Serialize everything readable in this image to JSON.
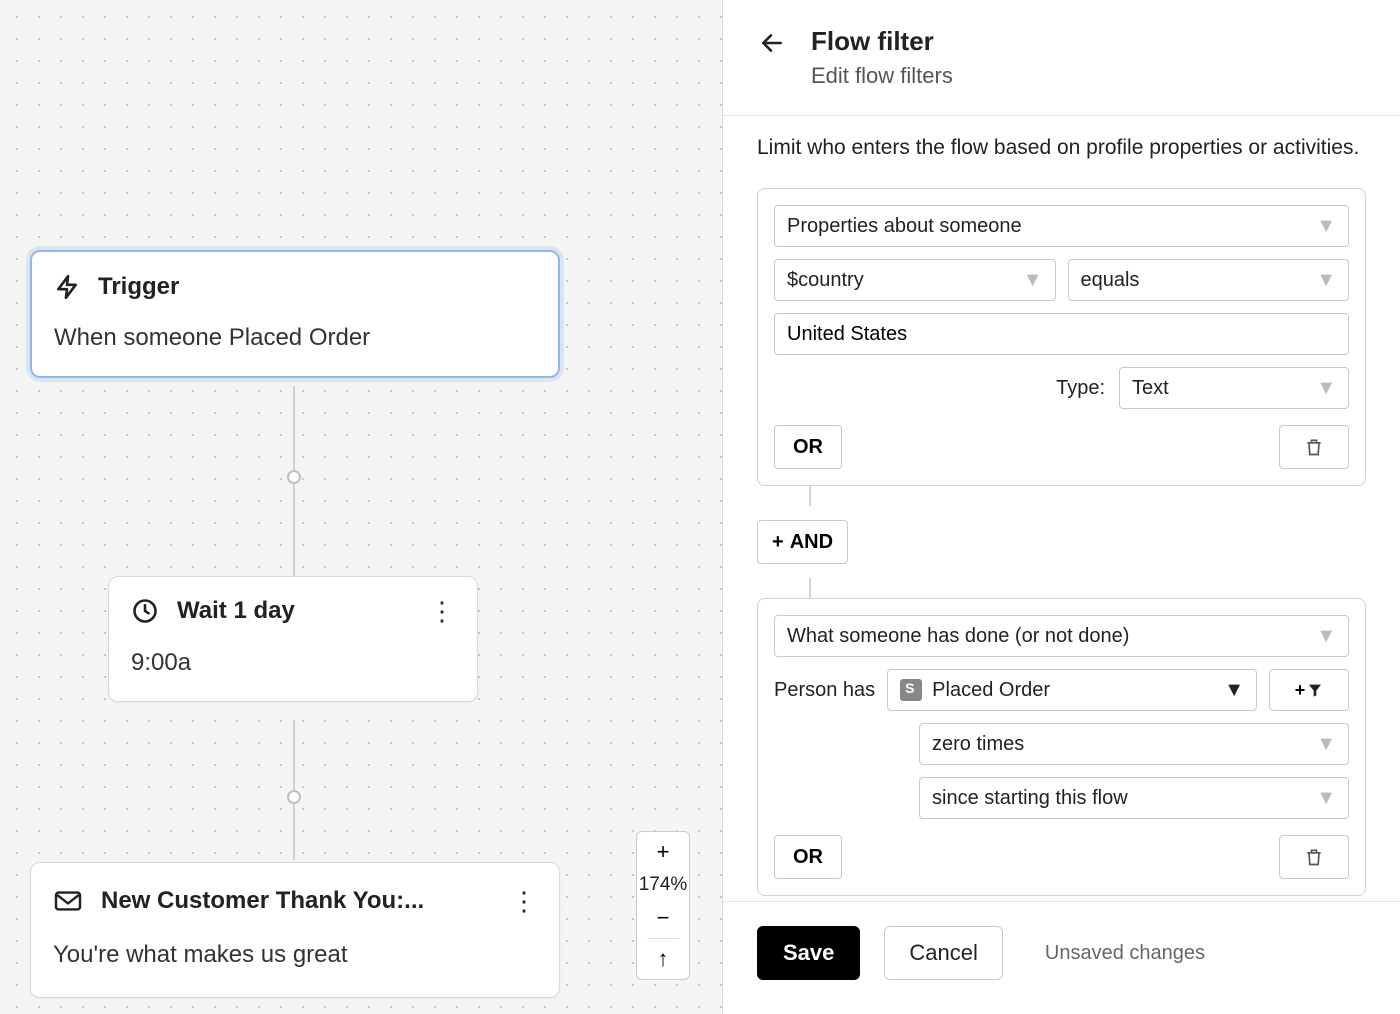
{
  "canvas": {
    "trigger": {
      "title": "Trigger",
      "description": "When someone Placed Order"
    },
    "wait": {
      "title": "Wait 1 day",
      "time": "9:00a"
    },
    "email": {
      "title": "New Customer Thank You:...",
      "subject": "You're what makes us great"
    },
    "zoom": {
      "value": "174%"
    }
  },
  "panel": {
    "title": "Flow filter",
    "subtitle": "Edit flow filters",
    "description": "Limit who enters the flow based on profile properties or activities.",
    "group1": {
      "condition_type": "Properties about someone",
      "property": "$country",
      "operator": "equals",
      "value": "United States",
      "type_label": "Type:",
      "type_value": "Text",
      "or_label": "OR"
    },
    "and_label": "AND",
    "group2": {
      "condition_type": "What someone has done (or not done)",
      "person_label": "Person has",
      "event": "Placed Order",
      "count": "zero times",
      "timeframe": "since starting this flow",
      "or_label": "OR"
    },
    "footer": {
      "save": "Save",
      "cancel": "Cancel",
      "unsaved": "Unsaved changes"
    }
  }
}
